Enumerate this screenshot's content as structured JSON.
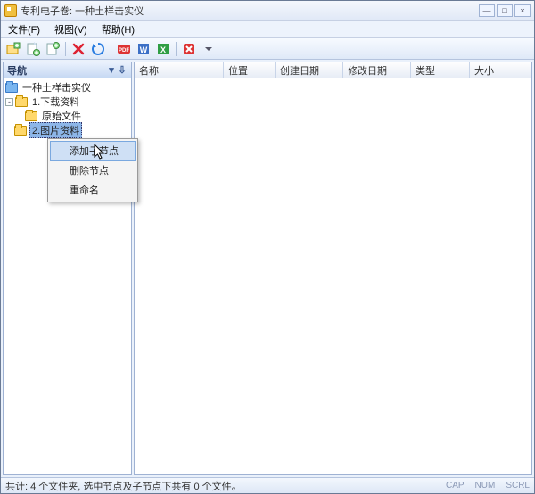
{
  "window": {
    "title": "专利电子卷: 一种土样击实仪"
  },
  "menu": {
    "file": "文件(F)",
    "view": "视图(V)",
    "help": "帮助(H)"
  },
  "nav": {
    "header": "导航",
    "root": "一种土样击实仪",
    "items": {
      "download": "1.下载资料",
      "original": "原始文件",
      "selected": "2.图片资料"
    }
  },
  "context_menu": {
    "add_child": "添加子节点",
    "delete_node": "删除节点",
    "rename": "重命名"
  },
  "list": {
    "columns": {
      "name": "名称",
      "location": "位置",
      "created": "创建日期",
      "modified": "修改日期",
      "type": "类型",
      "size": "大小"
    }
  },
  "status": {
    "text": "共计: 4 个文件夹, 选中节点及子节点下共有 0 个文件。",
    "cap": "CAP",
    "num": "NUM",
    "scrl": "SCRL"
  }
}
